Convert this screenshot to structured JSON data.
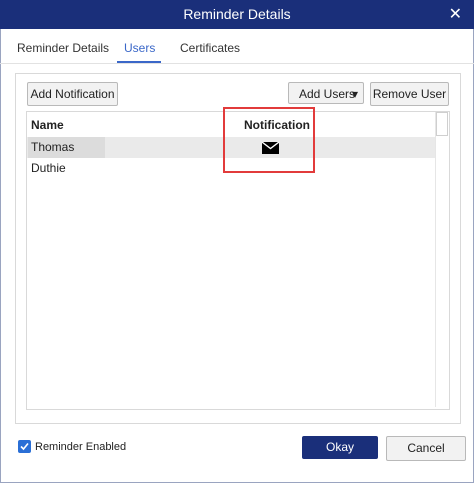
{
  "window": {
    "title": "Reminder Details",
    "close_glyph": "✕"
  },
  "tabs": [
    {
      "label": "Reminder Details",
      "active": false
    },
    {
      "label": "Users",
      "active": true
    },
    {
      "label": "Certificates",
      "active": false
    }
  ],
  "toolbar": {
    "add_notification": "Add Notification",
    "add_users": "Add Users",
    "add_users_chevron": "▾",
    "remove_user": "Remove User"
  },
  "table": {
    "columns": [
      "Name",
      "Notification"
    ],
    "rows": [
      {
        "name": "Thomas Duthie",
        "notification_icon": "envelope-icon"
      }
    ]
  },
  "footer": {
    "reminder_enabled_label": "Reminder Enabled",
    "reminder_enabled_checked": true,
    "okay": "Okay",
    "cancel": "Cancel"
  },
  "colors": {
    "titlebar": "#1a2f7a",
    "accent": "#3a67c8",
    "highlight": "#e23b3b",
    "primary_button": "#1a2f7a"
  }
}
